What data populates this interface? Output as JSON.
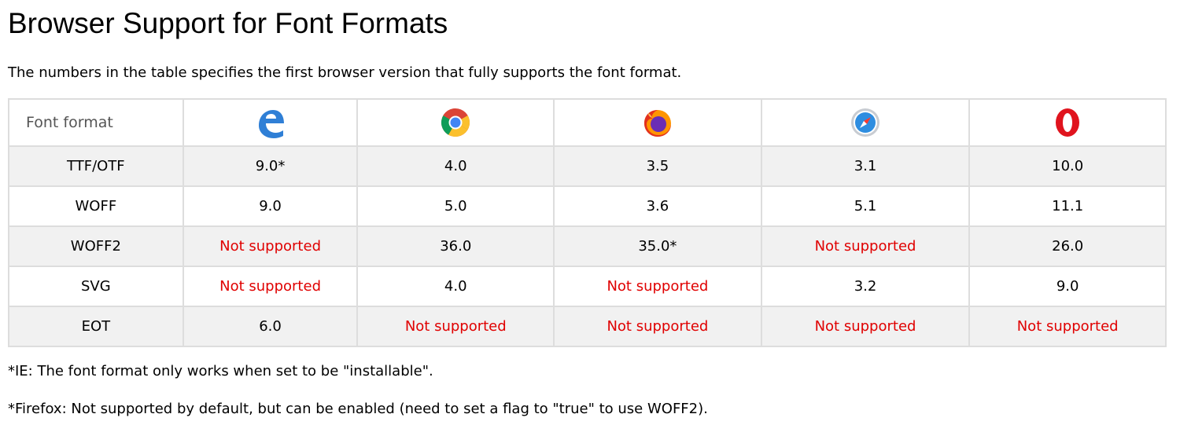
{
  "title": "Browser Support for Font Formats",
  "intro": "The numbers in the table specifies the first browser version that fully supports the font format.",
  "table": {
    "header_label": "Font format",
    "browsers": [
      {
        "icon": "edge-icon"
      },
      {
        "icon": "chrome-icon"
      },
      {
        "icon": "firefox-icon"
      },
      {
        "icon": "safari-icon"
      },
      {
        "icon": "opera-icon"
      }
    ],
    "rows": [
      {
        "format": "TTF/OTF",
        "values": [
          "9.0*",
          "4.0",
          "3.5",
          "3.1",
          "10.0"
        ]
      },
      {
        "format": "WOFF",
        "values": [
          "9.0",
          "5.0",
          "3.6",
          "5.1",
          "11.1"
        ]
      },
      {
        "format": "WOFF2",
        "values": [
          "Not supported",
          "36.0",
          "35.0*",
          "Not supported",
          "26.0"
        ]
      },
      {
        "format": "SVG",
        "values": [
          "Not supported",
          "4.0",
          "Not supported",
          "3.2",
          "9.0"
        ]
      },
      {
        "format": "EOT",
        "values": [
          "6.0",
          "Not supported",
          "Not supported",
          "Not supported",
          "Not supported"
        ]
      }
    ],
    "not_supported_color": "#e00000",
    "stripe_color": "#f1f1f1",
    "border_color": "#dddddd"
  },
  "notes": [
    "*IE: The font format only works when set to be \"installable\".",
    "*Firefox: Not supported by default, but can be enabled (need to set a flag to \"true\" to use WOFF2)."
  ]
}
